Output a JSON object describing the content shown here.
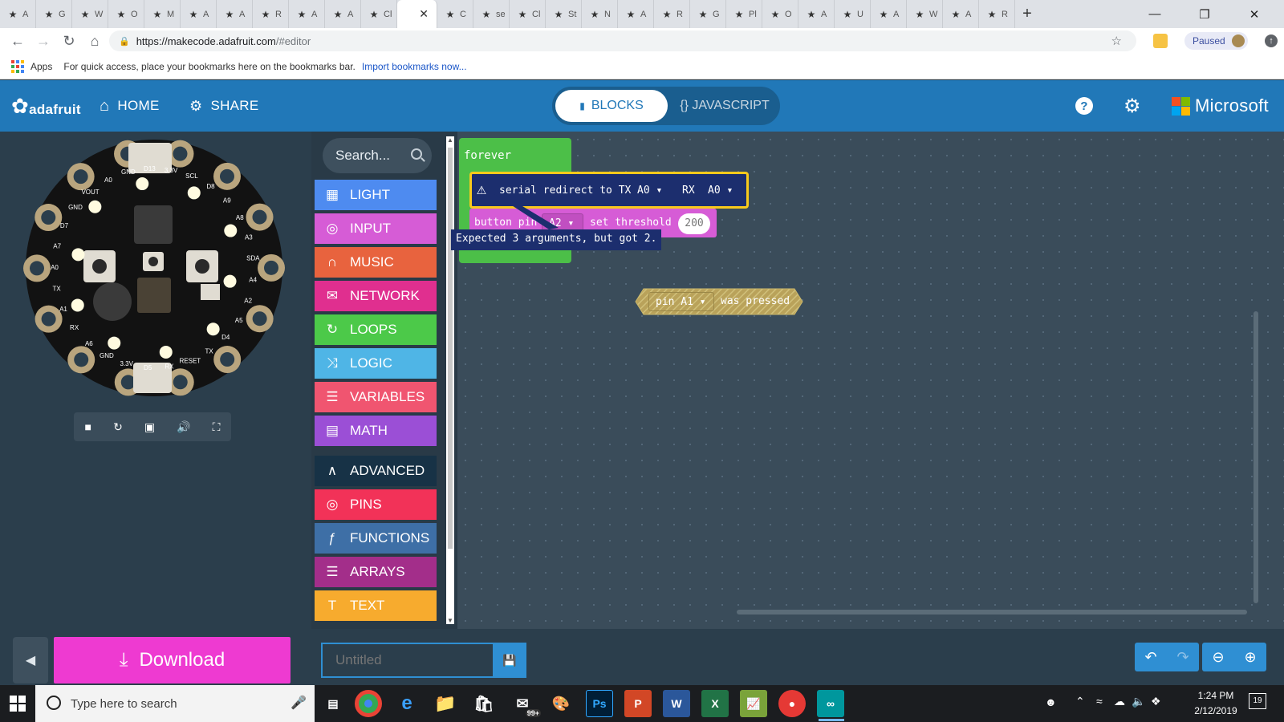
{
  "browser": {
    "tabs": [
      {
        "label": "A",
        "icon": "diamond-icon"
      },
      {
        "label": "G",
        "icon": "gmail-icon"
      },
      {
        "label": "W",
        "icon": "wallet-icon"
      },
      {
        "label": "O",
        "icon": "opera-icon"
      },
      {
        "label": "M",
        "icon": "leaf-icon"
      },
      {
        "label": "A",
        "icon": "amazon-icon"
      },
      {
        "label": "A",
        "icon": "amazon-icon"
      },
      {
        "label": "R",
        "icon": "gear-icon"
      },
      {
        "label": "A",
        "icon": "arduino-icon"
      },
      {
        "label": "A",
        "icon": "adafruit-icon"
      },
      {
        "label": "Cl",
        "icon": "adafruit-icon"
      },
      {
        "label": "",
        "icon": "",
        "active": true
      },
      {
        "label": "C",
        "icon": "star-icon"
      },
      {
        "label": "se",
        "icon": "bing-icon"
      },
      {
        "label": "Cl",
        "icon": "star-icon"
      },
      {
        "label": "St",
        "icon": "star-icon"
      },
      {
        "label": "N",
        "icon": "github-icon"
      },
      {
        "label": "A",
        "icon": "star-icon"
      },
      {
        "label": "R",
        "icon": "microsoft-icon"
      },
      {
        "label": "G",
        "icon": "github-icon"
      },
      {
        "label": "Pl",
        "icon": "adafruit-icon"
      },
      {
        "label": "O",
        "icon": "adafruit-icon"
      },
      {
        "label": "A",
        "icon": "adafruit-icon"
      },
      {
        "label": "U",
        "icon": "adafruit-icon"
      },
      {
        "label": "A",
        "icon": "star-icon"
      },
      {
        "label": "W",
        "icon": "adafruit-icon"
      },
      {
        "label": "A",
        "icon": "star-icon"
      },
      {
        "label": "R",
        "icon": "github-icon"
      }
    ],
    "new_tab": "+",
    "url_host": "https://makecode.adafruit.com",
    "url_rest": "/#editor",
    "paused_label": "Paused",
    "bookmarks": {
      "apps_label": "Apps",
      "hint_text": "For quick access, place your bookmarks here on the bookmarks bar.",
      "import_link": "Import bookmarks now..."
    }
  },
  "header": {
    "brand": "adafruit",
    "home_label": "HOME",
    "share_label": "SHARE",
    "blocks_label": "BLOCKS",
    "javascript_label": "{} JAVASCRIPT",
    "microsoft_label": "Microsoft"
  },
  "simulator": {
    "pin_labels": [
      "GND",
      "D13",
      "3.3V",
      "SCL",
      "D8",
      "A9",
      "A8",
      "A3",
      "SDA",
      "A4",
      "A2",
      "A5",
      "D4",
      "TX",
      "RESET",
      "RX",
      "D5",
      "3.3V",
      "GND",
      "A6",
      "RX",
      "A1",
      "TX",
      "A0",
      "A7",
      "D7",
      "GND",
      "VOUT",
      "A0"
    ],
    "controls": [
      "stop-icon",
      "restart-icon",
      "screenshot-icon",
      "mute-icon",
      "fullscreen-icon"
    ]
  },
  "toolbox": {
    "search_placeholder": "Search...",
    "categories": [
      {
        "label": "LIGHT",
        "color": "#4e8bf0",
        "icon": "grid-icon"
      },
      {
        "label": "INPUT",
        "color": "#d65cd6",
        "icon": "target-icon"
      },
      {
        "label": "MUSIC",
        "color": "#e8633e",
        "icon": "headphones-icon"
      },
      {
        "label": "NETWORK",
        "color": "#e02f8f",
        "icon": "chat-icon"
      },
      {
        "label": "LOOPS",
        "color": "#4cc949",
        "icon": "refresh-icon"
      },
      {
        "label": "LOGIC",
        "color": "#4fb5e6",
        "icon": "shuffle-icon"
      },
      {
        "label": "VARIABLES",
        "color": "#f05570",
        "icon": "list-icon"
      },
      {
        "label": "MATH",
        "color": "#9b4fd6",
        "icon": "calculator-icon"
      },
      {
        "label": "ADVANCED",
        "color": "#173246",
        "icon": "chevron-up-icon"
      },
      {
        "label": "PINS",
        "color": "#f23258",
        "icon": "target-icon"
      },
      {
        "label": "FUNCTIONS",
        "color": "#3e6fa6",
        "icon": "function-icon"
      },
      {
        "label": "ARRAYS",
        "color": "#a32e8a",
        "icon": "list-icon"
      },
      {
        "label": "TEXT",
        "color": "#f7ab2e",
        "icon": "text-icon"
      }
    ]
  },
  "workspace": {
    "forever_label": "forever",
    "serial_block": {
      "text": "serial redirect to TX",
      "tx_value": "A0",
      "rx_label": "RX",
      "rx_value": "A0"
    },
    "button_block": {
      "text": "button pin",
      "pin_value": "A2",
      "threshold_label": "set threshold",
      "threshold_value": "200"
    },
    "error_tooltip": "Expected 3 arguments, but got 2.",
    "pin_pressed_block": {
      "pin_value": "pin A1",
      "text": "was pressed"
    }
  },
  "bottom": {
    "download_label": "Download",
    "project_placeholder": "Untitled"
  },
  "taskbar": {
    "search_placeholder": "Type here to search",
    "time": "1:24 PM",
    "date": "2/12/2019",
    "notifications": "19",
    "mail_badge": "99+"
  }
}
